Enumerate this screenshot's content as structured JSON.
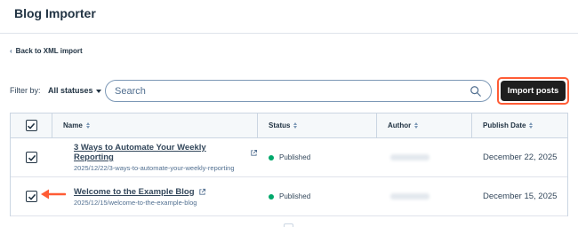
{
  "header": {
    "title": "Blog Importer"
  },
  "nav": {
    "back_label": "Back to XML import"
  },
  "filters": {
    "label": "Filter by:",
    "status_value": "All statuses",
    "search_placeholder": "Search",
    "import_label": "Import posts"
  },
  "table": {
    "columns": [
      "Name",
      "Status",
      "Author",
      "Publish Date"
    ],
    "rows": [
      {
        "checked": true,
        "title": "3 Ways to Automate Your Weekly Reporting",
        "slug": "2025/12/22/3-ways-to-automate-your-weekly-reporting",
        "status": "Published",
        "publish_date": "December 22, 2025"
      },
      {
        "checked": true,
        "title": "Welcome to the Example Blog",
        "slug": "2025/12/15/welcome-to-the-example-blog",
        "status": "Published",
        "publish_date": "December 15, 2025"
      }
    ]
  },
  "colors": {
    "accent": "#ff5c35",
    "published_dot": "#00a86b",
    "button_bg": "#1f1f1f"
  }
}
